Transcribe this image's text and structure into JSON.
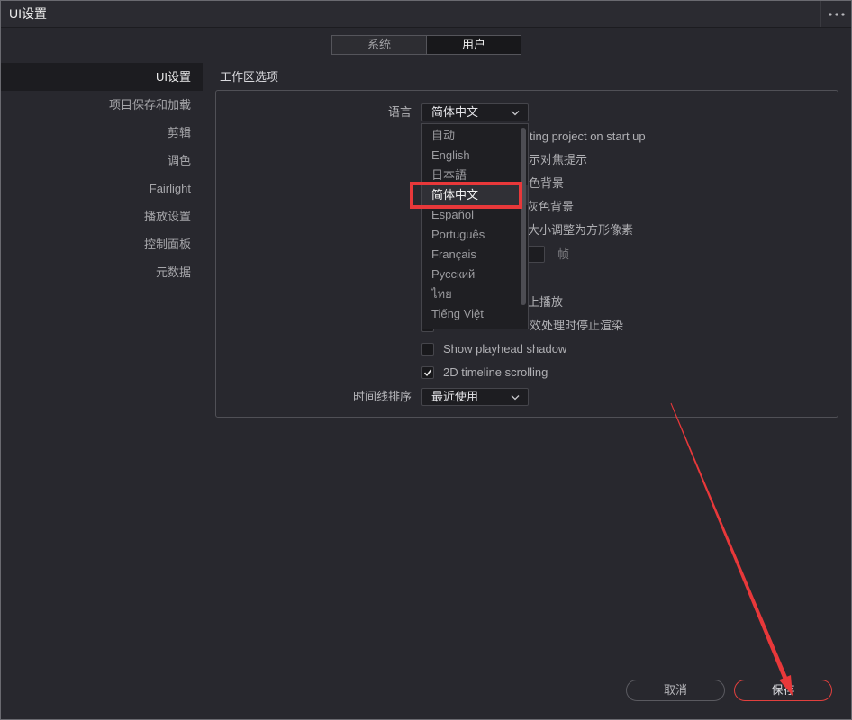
{
  "window": {
    "title": "UI设置",
    "menu_icon": "more-horizontal-icon"
  },
  "tabs": [
    {
      "label": "系统",
      "selected": false
    },
    {
      "label": "用户",
      "selected": true
    }
  ],
  "sidebar": {
    "items": [
      {
        "label": "UI设置",
        "selected": true
      },
      {
        "label": "项目保存和加载",
        "selected": false
      },
      {
        "label": "剪辑",
        "selected": false
      },
      {
        "label": "调色",
        "selected": false
      },
      {
        "label": "Fairlight",
        "selected": false
      },
      {
        "label": "播放设置",
        "selected": false
      },
      {
        "label": "控制面板",
        "selected": false
      },
      {
        "label": "元数据",
        "selected": false
      }
    ]
  },
  "workspace": {
    "title": "工作区选项",
    "language": {
      "label": "语言",
      "value": "简体中文",
      "dropdown_open": true,
      "options": [
        {
          "label": "自动",
          "highlighted": false
        },
        {
          "label": "English",
          "highlighted": false
        },
        {
          "label": "日本語",
          "highlighted": false
        },
        {
          "label": "简体中文",
          "highlighted": true
        },
        {
          "label": "Español",
          "highlighted": false
        },
        {
          "label": "Português",
          "highlighted": false
        },
        {
          "label": "Français",
          "highlighted": false
        },
        {
          "label": "Русский",
          "highlighted": false
        },
        {
          "label": "ไทย",
          "highlighted": false
        },
        {
          "label": "Tiếng Việt",
          "highlighted": false
        }
      ]
    },
    "partially_hidden_rows": [
      {
        "text": "ting project on start up"
      },
      {
        "text": "示对焦提示"
      },
      {
        "text": "色背景"
      },
      {
        "text": "灰色背景"
      },
      {
        "text": "大小调整为方形像素"
      },
      {
        "unit": "帧"
      },
      {
        "text": "上播放"
      },
      {
        "text": "效处理时停止渲染",
        "checked": false
      }
    ],
    "show_playhead_shadow": {
      "label": "Show playhead shadow",
      "checked": false
    },
    "timeline_scrolling_2d": {
      "label": "2D timeline scrolling",
      "checked": true
    },
    "timeline_sort": {
      "label": "时间线排序",
      "value": "最近使用"
    }
  },
  "footer": {
    "cancel_label": "取消",
    "save_label": "保存"
  },
  "icons": {
    "dropdown": "chevron-down-icon",
    "checkbox_mark": "checkmark-icon"
  },
  "colors": {
    "background": "#28282e",
    "annotation_red": "#e8383a",
    "save_button_border": "#e2403e"
  }
}
